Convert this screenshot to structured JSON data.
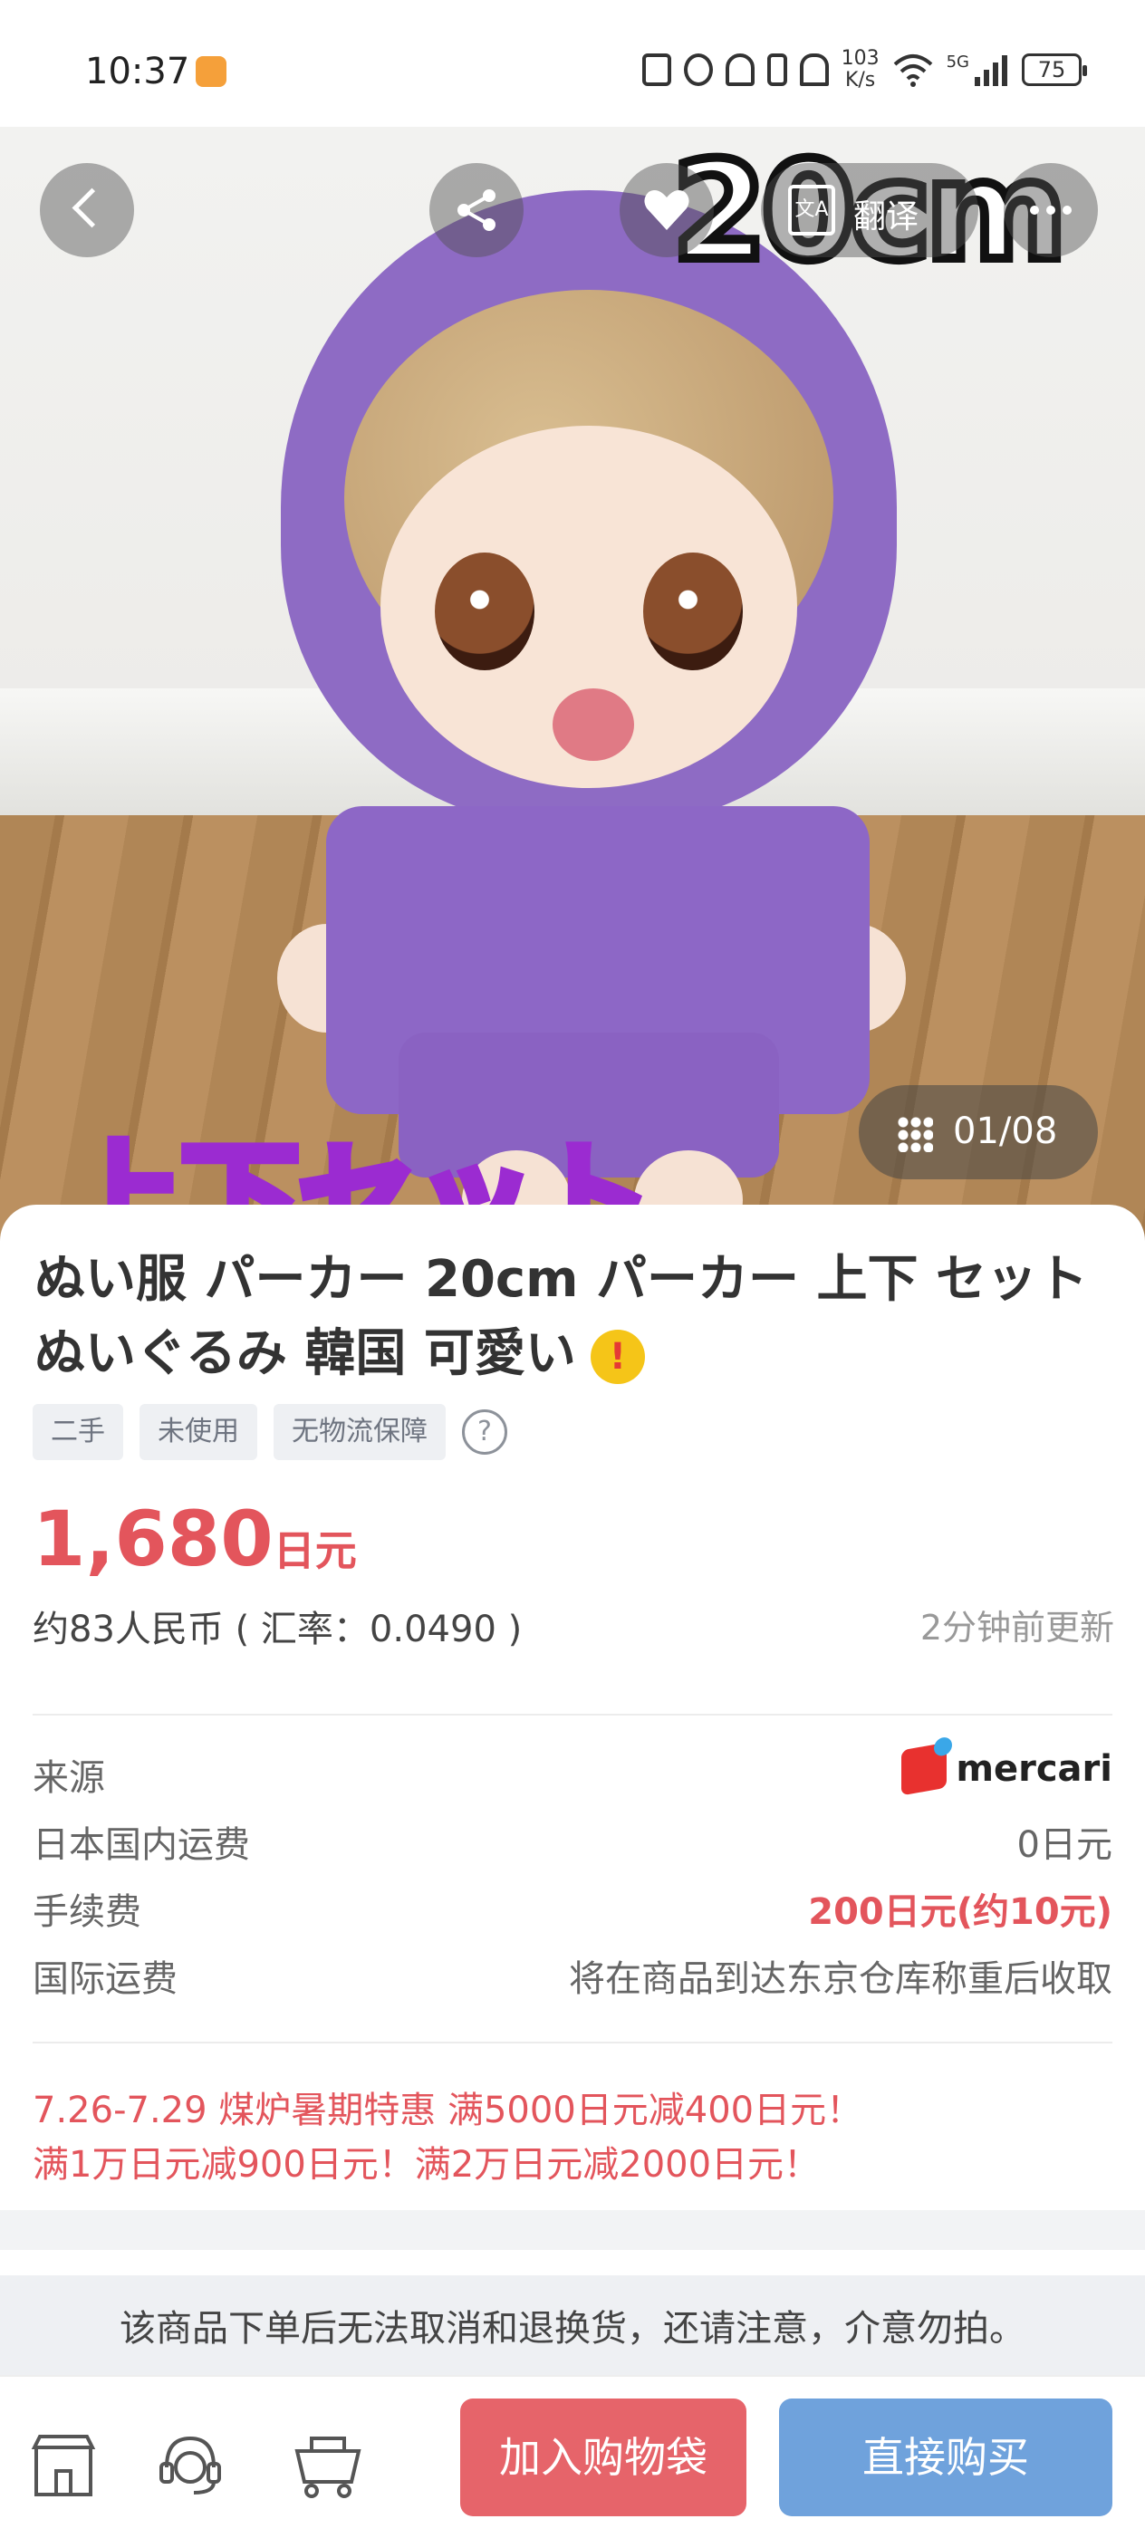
{
  "status_bar": {
    "time": "10:37",
    "speed_top": "103",
    "speed_bottom": "K/s",
    "network": "5G",
    "battery": "75"
  },
  "photo": {
    "overlay_size_text": "20cm",
    "overlay_jp_text": "上下セット",
    "translate_label": "翻译",
    "translate_icon_glyph": "文A",
    "image_counter": "01/08"
  },
  "product": {
    "title": "ぬい服 パーカー 20cm パーカー 上下 セット ぬいぐるみ 韓国 可愛い",
    "warning_icon_glyph": "!",
    "tags": [
      "二手",
      "未使用",
      "无物流保障"
    ],
    "help_icon_glyph": "?",
    "price_number": "1,680",
    "price_unit": "日元",
    "rmb_line": "约83人民币 ( 汇率：0.0490 )",
    "updated": "2分钟前更新"
  },
  "details": {
    "source_label": "来源",
    "source_brand": "mercari",
    "domestic_shipping_label": "日本国内运费",
    "domestic_shipping_value": "0日元",
    "fee_label": "手续费",
    "fee_value": "200日元(约10元)",
    "intl_shipping_label": "国际运费",
    "intl_shipping_value": "将在商品到达东京仓库称重后收取"
  },
  "promo": {
    "line1": "7.26-7.29  煤炉暑期特惠 满5000日元减400日元！",
    "line2": "满1万日元减900日元！满2万日元减2000日元！"
  },
  "notice": "该商品下单后无法取消和退换货，还请注意，介意勿拍。",
  "bottom_bar": {
    "add_to_bag": "加入购物袋",
    "buy_now": "直接购买"
  },
  "colors": {
    "accent_red": "#e3555c",
    "buy_blue": "#6fa2dc",
    "bag_red": "#e6646a"
  }
}
